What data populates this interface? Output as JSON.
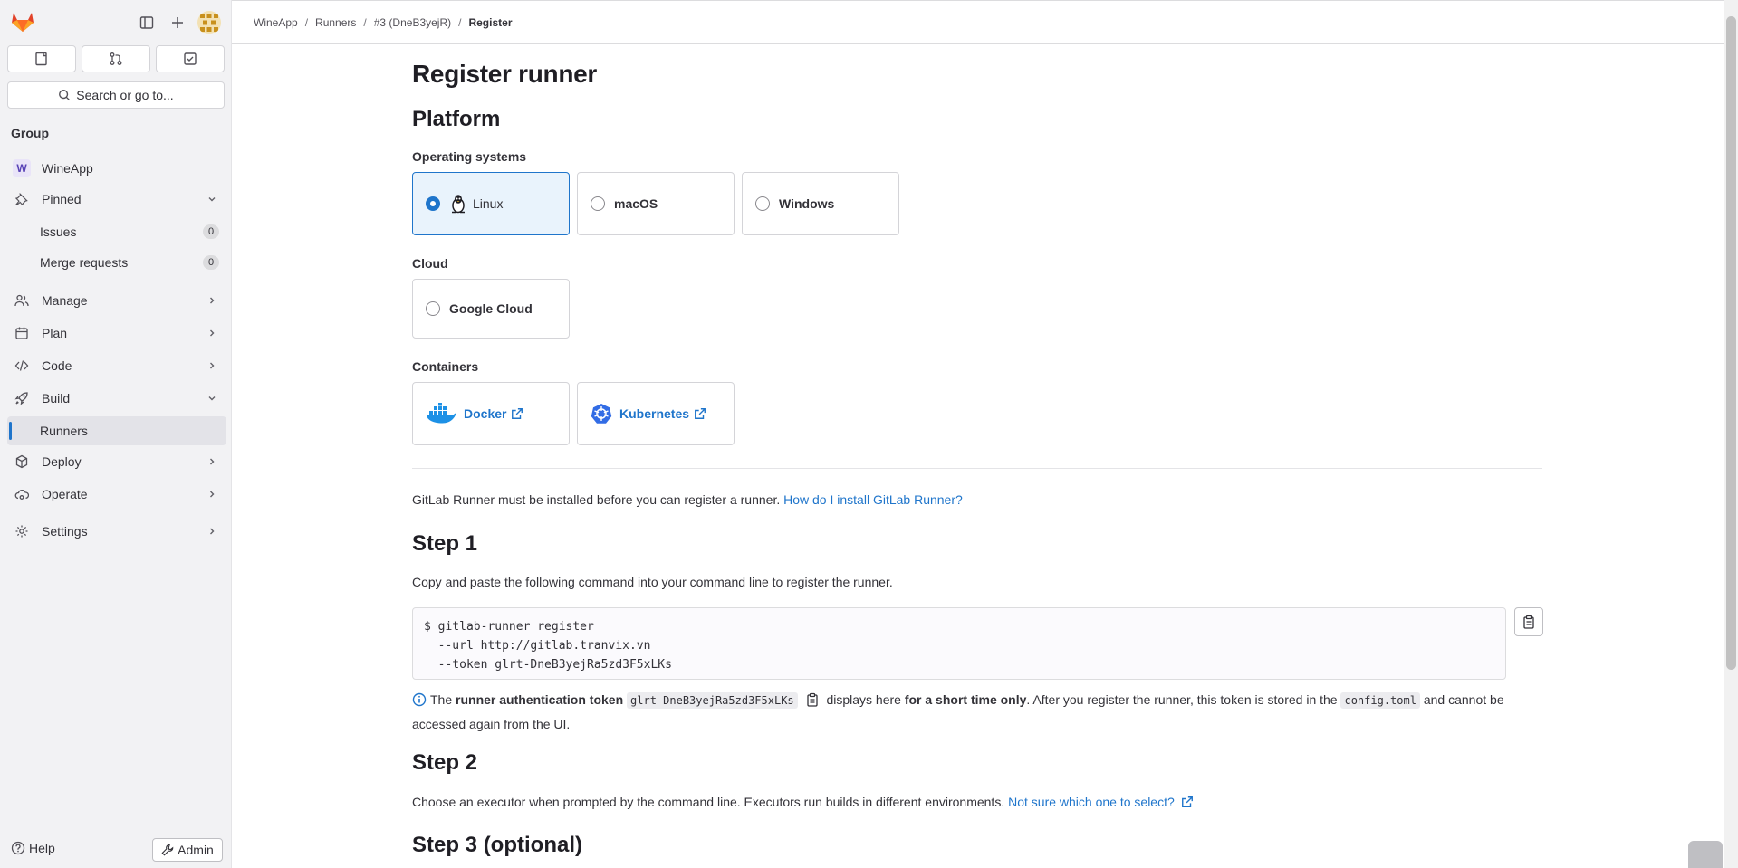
{
  "sidebar": {
    "search_label": "Search or go to...",
    "context_heading": "Group",
    "group": {
      "initial": "W",
      "name": "WineApp"
    },
    "pinned": {
      "label": "Pinned",
      "items": [
        {
          "label": "Issues",
          "count": "0"
        },
        {
          "label": "Merge requests",
          "count": "0"
        }
      ]
    },
    "sections": {
      "manage": "Manage",
      "plan": "Plan",
      "code": "Code",
      "build": "Build",
      "runners": "Runners",
      "deploy": "Deploy",
      "operate": "Operate",
      "settings": "Settings"
    },
    "help_label": "Help",
    "admin_label": "Admin"
  },
  "breadcrumbs": {
    "items": [
      "WineApp",
      "Runners",
      "#3 (DneB3yejR)"
    ],
    "current": "Register"
  },
  "page": {
    "title": "Register runner",
    "platform_heading": "Platform",
    "os_label": "Operating systems",
    "os_options": [
      {
        "label": "Linux",
        "selected": true
      },
      {
        "label": "macOS",
        "selected": false
      },
      {
        "label": "Windows",
        "selected": false
      }
    ],
    "cloud_label": "Cloud",
    "cloud_options": [
      {
        "label": "Google Cloud",
        "selected": false
      }
    ],
    "containers_label": "Containers",
    "container_options": [
      {
        "label": "Docker",
        "icon": "docker-icon"
      },
      {
        "label": "Kubernetes",
        "icon": "kubernetes-icon"
      }
    ],
    "install_text": "GitLab Runner must be installed before you can register a runner.",
    "install_link": "How do I install GitLab Runner?",
    "step1_heading": "Step 1",
    "step1_text": "Copy and paste the following command into your command line to register the runner.",
    "command": "$ gitlab-runner register\n  --url http://gitlab.tranvix.vn\n  --token glrt-DneB3yejRa5zd3F5xLKs",
    "info": {
      "prefix": "The",
      "bold1": "runner authentication token",
      "token": "glrt-DneB3yejRa5zd3F5xLKs",
      "mid": "displays here",
      "bold2": "for a short time only",
      "after": ". After you register the runner, this token is stored in the",
      "file": "config.toml",
      "end": "and cannot be accessed again from the UI."
    },
    "step2_heading": "Step 2",
    "step2_text": "Choose an executor when prompted by the command line. Executors run builds in different environments.",
    "step2_link": "Not sure which one to select?",
    "step3_heading": "Step 3 (optional)"
  },
  "colors": {
    "accent": "#1f75cb",
    "selected_bg": "#e9f3fc",
    "sidebar_bg": "#f2f2f4"
  }
}
